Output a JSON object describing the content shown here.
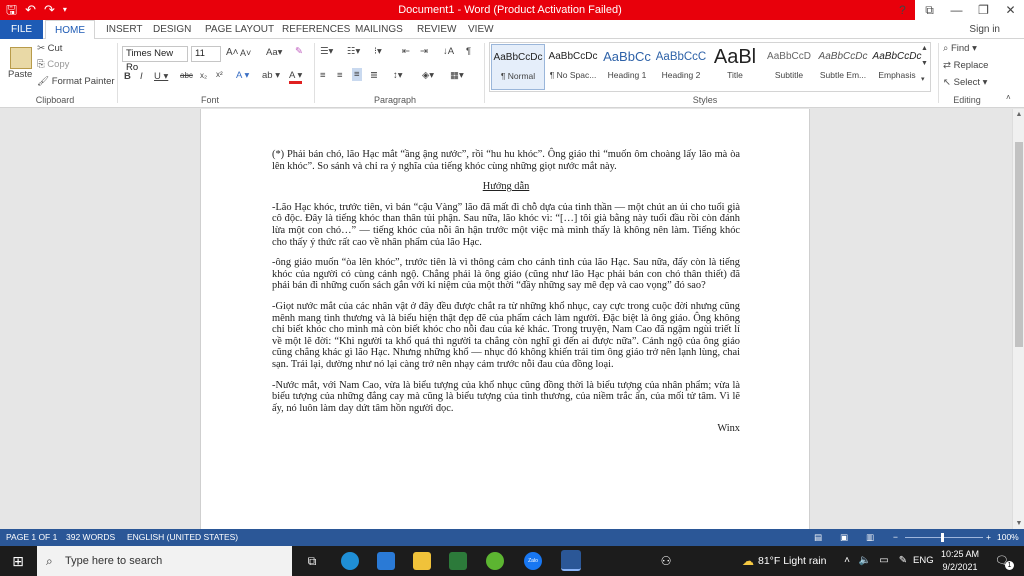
{
  "window": {
    "title": "Document1 - Word (Product Activation Failed)",
    "controls": [
      "?",
      "⧉",
      "—",
      "❐",
      "✕"
    ]
  },
  "qat": {
    "save_icon": "save-icon",
    "undo_icon": "undo-icon",
    "redo_icon": "redo-icon"
  },
  "tabs": [
    "FILE",
    "HOME",
    "INSERT",
    "DESIGN",
    "PAGE LAYOUT",
    "REFERENCES",
    "MAILINGS",
    "REVIEW",
    "VIEW"
  ],
  "signin": "Sign in",
  "ribbon": {
    "clipboard": {
      "paste": "Paste",
      "cut": "Cut",
      "copy": "Copy",
      "format_painter": "Format Painter",
      "label": "Clipboard"
    },
    "font": {
      "name": "Times New Ro",
      "size": "11",
      "label": "Font",
      "aa": "Aa",
      "grow": "A",
      "shrink": "A"
    },
    "paragraph": {
      "label": "Paragraph"
    },
    "styles": {
      "label": "Styles",
      "items": [
        {
          "sample": "AaBbCcDc",
          "name": "¶ Normal"
        },
        {
          "sample": "AaBbCcDc",
          "name": "¶ No Spac..."
        },
        {
          "sample": "AaBbCc",
          "name": "Heading 1"
        },
        {
          "sample": "AaBbCcC",
          "name": "Heading 2"
        },
        {
          "sample": "AaBl",
          "name": "Title"
        },
        {
          "sample": "AaBbCcD",
          "name": "Subtitle"
        },
        {
          "sample": "AaBbCcDc",
          "name": "Subtle Em..."
        },
        {
          "sample": "AaBbCcDc",
          "name": "Emphasis"
        }
      ]
    },
    "editing": {
      "find": "Find",
      "replace": "Replace",
      "select": "Select",
      "label": "Editing"
    }
  },
  "document": {
    "paragraphs": [
      "(*) Phải bán chó, lão Hạc mắt “ầng ậng nước”, rồi “hu hu khóc”. Ông giáo thì “muốn ôm choàng lấy lão mà òa lên khóc”. So sánh và chỉ ra ý nghĩa của tiếng khóc cùng những giọt nước mắt này.",
      "-Lão Hạc khóc, trước tiên, vì bán “cậu Vàng” lão đã mất đi chỗ dựa của tinh thần — một chút an ủi cho tuổi già cô độc. Đây là tiếng khóc than thân tủi phận. Sau nữa, lão khóc vì: “[…] tôi già bằng này tuổi đầu rồi còn đánh lừa một con chó…” — tiếng khóc của nỗi ân hận trước một việc mà mình thấy là không nên làm. Tiếng khóc cho thấy ý thức rất cao về nhân phẩm của lão Hạc.",
      "-ông giáo muốn “òa lên khóc”, trước tiên là vì thông cảm cho cảnh tình của lão Hạc. Sau nữa, đấy còn là tiếng khóc của người có cùng cảnh ngộ. Chẳng phải là ông giáo (cũng như lão Hạc phải bán con chó thân thiết) đã phải bán đi những cuốn sách gắn với kỉ niệm của một thời “đầy những say mê đẹp và cao vọng” đó sao?",
      "-Giọt nước mắt của các nhân vật ở đây đều được chắt ra từ những khổ nhục, cay cực trong cuộc đời nhưng cũng mênh mang tình thương và là biểu hiện thật đẹp đẽ của phẩm cách làm người. Đặc biệt là ông giáo. Ông không chỉ biết khóc cho mình mà còn biết khóc cho nỗi đau của kẻ khác. Trong truyện, Nam Cao đã ngậm ngùi triết lí về một lẽ đời: “Khi người ta khổ quá thì người ta chẳng còn nghĩ gì đến ai được nữa”. Cảnh ngộ của ông giáo cũng chẳng khác gì lão Hạc. Nhưng những khổ — nhục đó không khiến trái tim ông giáo trở nên lạnh lùng, chai sạn. Trái lại, dường như nó lại càng trở nên nhạy cảm trước nỗi đau của đồng loại.",
      "-Nước mắt, với Nam Cao, vừa là biểu tượng của khổ nhục cũng đồng thời là biểu tượng của nhân phẩm; vừa là biểu tượng của những đắng cay mà cũng là biểu tượng của tình thương, của niềm trắc ẩn, của mối tử tâm. Vì lẽ ấy, nó luôn làm day dứt tâm hồn người đọc."
    ],
    "heading": "Hướng dẫn",
    "signature": "Winx"
  },
  "status": {
    "page": "PAGE 1 OF 1",
    "words": "392 WORDS",
    "language": "ENGLISH (UNITED STATES)",
    "zoom": "100%"
  },
  "taskbar": {
    "search_placeholder": "Type here to search",
    "weather": "81°F  Light rain",
    "lang": "ENG",
    "time": "10:25 AM",
    "date": "9/2/2021",
    "notifications": "1",
    "zalo_label": "Zalo"
  }
}
